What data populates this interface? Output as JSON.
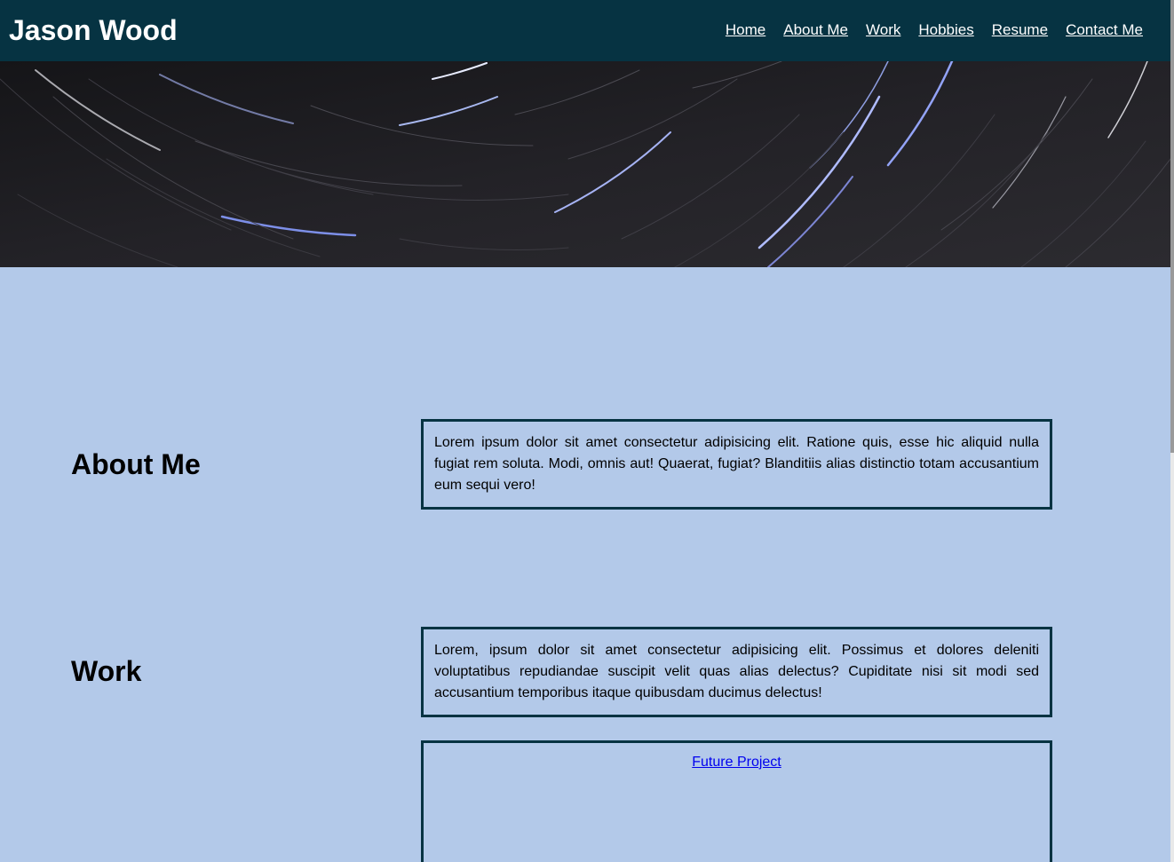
{
  "header": {
    "site_title": "Jason Wood",
    "nav": [
      "Home",
      "About Me",
      "Work",
      "Hobbies",
      "Resume",
      "Contact Me"
    ]
  },
  "hero": {
    "image": "star-trails"
  },
  "about": {
    "heading": "About Me",
    "text": "Lorem ipsum dolor sit amet consectetur adipisicing elit. Ratione quis, esse hic aliquid nulla fugiat rem soluta. Modi, omnis aut! Quaerat, fugiat? Blanditiis alias distinctio totam accusantium eum sequi vero!"
  },
  "work": {
    "heading": "Work",
    "text": "Lorem, ipsum dolor sit amet consectetur adipisicing elit. Possimus et dolores deleniti voluptatibus repudiandae suscipit velit quas alias delectus? Cupiditate nisi sit modi sed accusantium temporibus itaque quibusdam ducimus delectus!",
    "project_link": "Future Project"
  },
  "colors": {
    "header_bg": "#063342",
    "page_bg": "#b3c9e9",
    "border": "#063342",
    "link": "#0000ee"
  }
}
